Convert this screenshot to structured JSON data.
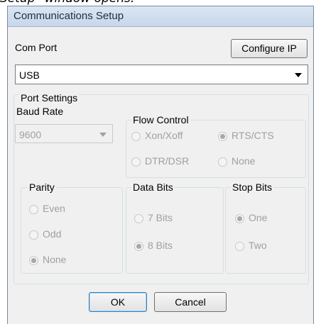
{
  "caption": "Setup\" window opens.",
  "window": {
    "title": "Communications Setup"
  },
  "com_port": {
    "label": "Com Port",
    "configure_ip_label": "Configure IP",
    "selected": "USB"
  },
  "port_settings": {
    "title": "Port Settings",
    "baud_rate": {
      "label": "Baud Rate",
      "selected": "9600"
    },
    "flow_control": {
      "title": "Flow Control",
      "options": [
        "Xon/Xoff",
        "RTS/CTS",
        "DTR/DSR",
        "None"
      ],
      "selected": "RTS/CTS"
    },
    "parity": {
      "title": "Parity",
      "options": [
        "Even",
        "Odd",
        "None"
      ],
      "selected": "None"
    },
    "data_bits": {
      "title": "Data Bits",
      "options": [
        "7 Bits",
        "8 Bits"
      ],
      "selected": "8 Bits"
    },
    "stop_bits": {
      "title": "Stop Bits",
      "options": [
        "One",
        "Two"
      ],
      "selected": "One"
    }
  },
  "buttons": {
    "ok": "OK",
    "cancel": "Cancel"
  }
}
